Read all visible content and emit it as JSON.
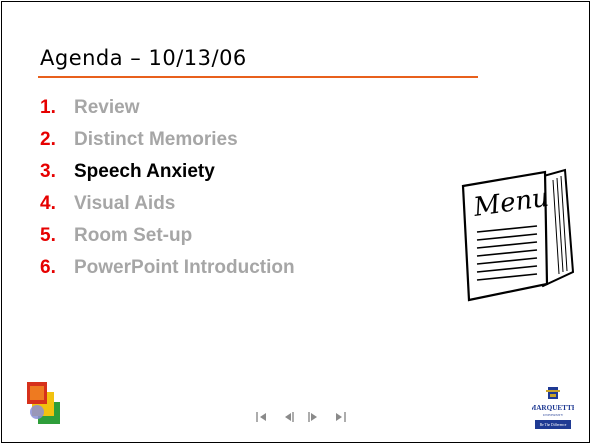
{
  "slide": {
    "title": "Agenda – 10/13/06",
    "agenda_items": [
      {
        "number": "1.",
        "label": "Review",
        "current": false
      },
      {
        "number": "2.",
        "label": "Distinct Memories",
        "current": false
      },
      {
        "number": "3.",
        "label": "Speech Anxiety",
        "current": true
      },
      {
        "number": "4.",
        "label": "Visual Aids",
        "current": false
      },
      {
        "number": "5.",
        "label": "Room Set-up",
        "current": false
      },
      {
        "number": "6.",
        "label": "PowerPoint Introduction",
        "current": false
      }
    ],
    "menu_card_text": "Menu"
  },
  "navigation": {
    "icons": [
      "first-slide-icon",
      "previous-slide-icon",
      "next-slide-icon",
      "last-slide-icon"
    ]
  },
  "branding": {
    "university_name": "MARQUETTE",
    "university_sub": "UNIVERSITY",
    "tagline": "Be The Difference"
  },
  "colors": {
    "accent_rule": "#e8601c",
    "item_number": "#e60000",
    "item_inactive": "#a6a6a6",
    "item_active": "#000000",
    "marquette_blue": "#1f3a93"
  }
}
